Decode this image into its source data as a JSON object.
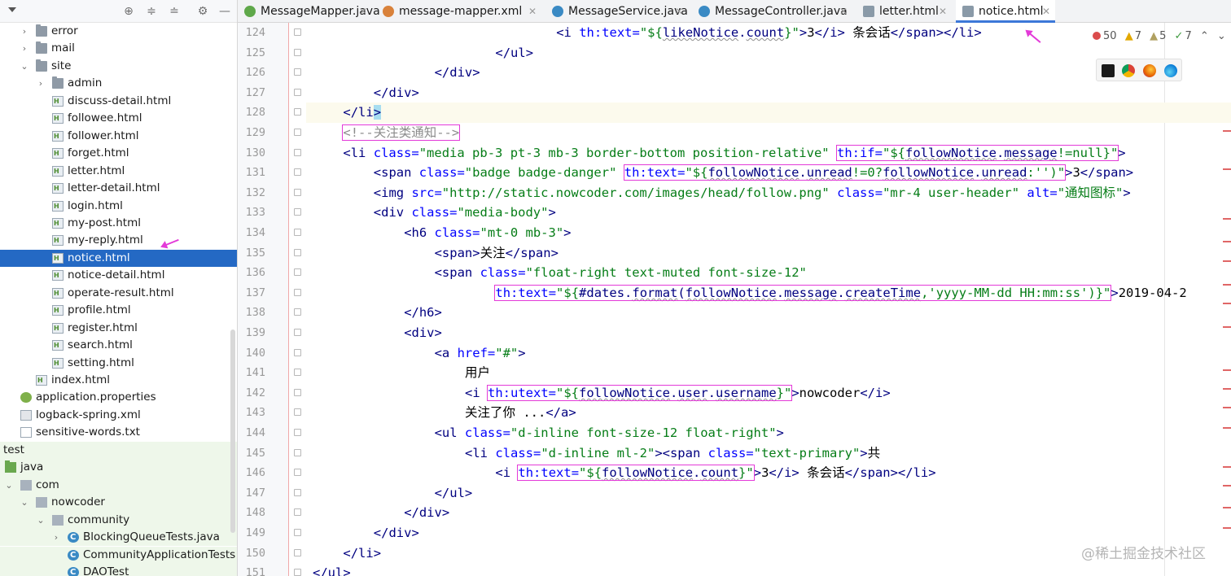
{
  "sidebar": {
    "toolbar_icons": [
      "dropdown-arrow-icon",
      "target-icon",
      "expand-all-icon",
      "collapse-all-icon",
      "gear-icon",
      "hide-icon"
    ],
    "items": [
      {
        "label": "error",
        "type": "folder",
        "expanded": false
      },
      {
        "label": "mail",
        "type": "folder",
        "expanded": false
      },
      {
        "label": "site",
        "type": "folder",
        "expanded": true
      },
      {
        "label": "admin",
        "type": "folder",
        "expanded": false
      },
      {
        "label": "discuss-detail.html",
        "type": "html"
      },
      {
        "label": "followee.html",
        "type": "html"
      },
      {
        "label": "follower.html",
        "type": "html"
      },
      {
        "label": "forget.html",
        "type": "html"
      },
      {
        "label": "letter.html",
        "type": "html"
      },
      {
        "label": "letter-detail.html",
        "type": "html"
      },
      {
        "label": "login.html",
        "type": "html"
      },
      {
        "label": "my-post.html",
        "type": "html"
      },
      {
        "label": "my-reply.html",
        "type": "html"
      },
      {
        "label": "notice.html",
        "type": "html",
        "selected": true
      },
      {
        "label": "notice-detail.html",
        "type": "html"
      },
      {
        "label": "operate-result.html",
        "type": "html"
      },
      {
        "label": "profile.html",
        "type": "html"
      },
      {
        "label": "register.html",
        "type": "html"
      },
      {
        "label": "search.html",
        "type": "html"
      },
      {
        "label": "setting.html",
        "type": "html"
      },
      {
        "label": "index.html",
        "type": "html"
      },
      {
        "label": "application.properties",
        "type": "props"
      },
      {
        "label": "logback-spring.xml",
        "type": "xml"
      },
      {
        "label": "sensitive-words.txt",
        "type": "txt"
      },
      {
        "label": "test",
        "type": "plain"
      },
      {
        "label": "java",
        "type": "folder-green"
      },
      {
        "label": "com",
        "type": "pkg",
        "expanded": true
      },
      {
        "label": "nowcoder",
        "type": "pkg",
        "expanded": true
      },
      {
        "label": "community",
        "type": "pkg",
        "expanded": true
      },
      {
        "label": "BlockingQueueTests.java",
        "type": "javac",
        "expanded": false
      },
      {
        "label": "CommunityApplicationTests",
        "type": "javac"
      },
      {
        "label": "DAOTest",
        "type": "javac"
      }
    ]
  },
  "tabs": [
    {
      "label": "MessageMapper.java",
      "icon": "interface-icon",
      "color": "#5fa84a"
    },
    {
      "label": "message-mapper.xml",
      "icon": "xml-icon",
      "color": "#d9823b"
    },
    {
      "label": "MessageService.java",
      "icon": "class-icon",
      "color": "#3a8ac4"
    },
    {
      "label": "MessageController.java",
      "icon": "class-icon",
      "color": "#3a8ac4"
    },
    {
      "label": "letter.html",
      "icon": "html-icon",
      "color": "#8a9aa8"
    },
    {
      "label": "notice.html",
      "icon": "html-icon",
      "color": "#8a9aa8",
      "active": true
    }
  ],
  "inspections": {
    "errors": "50",
    "warnings": "7",
    "weak_warnings": "5",
    "ok": "7"
  },
  "browsers": [
    "intellij-icon",
    "chrome-icon",
    "firefox-icon",
    "edge-icon"
  ],
  "editor": {
    "lines": [
      {
        "n": "124",
        "indent": 10,
        "tokens": [
          {
            "t": "<i ",
            "c": "tg"
          },
          {
            "t": "th:text=",
            "c": "at"
          },
          {
            "t": "\"${",
            "c": "sv"
          },
          {
            "t": "likeNotice",
            "c": "ex ul"
          },
          {
            "t": ".",
            "c": "ex"
          },
          {
            "t": "count",
            "c": "ex ul"
          },
          {
            "t": "}\"",
            "c": "sv"
          },
          {
            "t": ">",
            "c": "tg"
          },
          {
            "t": "3",
            "c": "tx"
          },
          {
            "t": "</i>",
            "c": "tg"
          },
          {
            "t": " 条会话",
            "c": "tx"
          },
          {
            "t": "</span></li>",
            "c": "tg"
          }
        ]
      },
      {
        "n": "125",
        "indent": 8,
        "tokens": [
          {
            "t": "</ul>",
            "c": "tg"
          }
        ]
      },
      {
        "n": "126",
        "indent": 6,
        "tokens": [
          {
            "t": "</div>",
            "c": "tg"
          }
        ]
      },
      {
        "n": "127",
        "indent": 4,
        "tokens": [
          {
            "t": "</div>",
            "c": "tg"
          }
        ]
      },
      {
        "n": "128",
        "indent": 3,
        "hl": true,
        "tokens": [
          {
            "t": "</li",
            "c": "tg"
          },
          {
            "t": ">",
            "c": "tg brk"
          }
        ]
      },
      {
        "n": "129",
        "indent": 3,
        "tokens": [
          {
            "t": "<!--关注类通知-->",
            "c": "cm box"
          }
        ]
      },
      {
        "n": "130",
        "indent": 3,
        "tokens": [
          {
            "t": "<li ",
            "c": "tg"
          },
          {
            "t": "class=",
            "c": "at"
          },
          {
            "t": "\"media pb-3 pt-3 mb-3 border-bottom position-relative\"",
            "c": "sv"
          },
          {
            "t": " ",
            "c": "tx"
          },
          {
            "t": "th:if=\"${followNotice.message!=null}\"",
            "c": "box",
            "parts": [
              {
                "t": "th:if=",
                "c": "at"
              },
              {
                "t": "\"${",
                "c": "sv"
              },
              {
                "t": "followNotice",
                "c": "ex ul"
              },
              {
                "t": ".",
                "c": "ex"
              },
              {
                "t": "message",
                "c": "ex ul"
              },
              {
                "t": "!=null}\"",
                "c": "sv"
              }
            ]
          },
          {
            "t": ">",
            "c": "tg"
          }
        ]
      },
      {
        "n": "131",
        "indent": 4,
        "tokens": [
          {
            "t": "<span ",
            "c": "tg"
          },
          {
            "t": "class=",
            "c": "at"
          },
          {
            "t": "\"badge badge-danger\"",
            "c": "sv"
          },
          {
            "t": " ",
            "c": "tx"
          },
          {
            "t": "th:text",
            "c": "box",
            "parts": [
              {
                "t": "th:text=",
                "c": "at"
              },
              {
                "t": "\"${",
                "c": "sv"
              },
              {
                "t": "followNotice",
                "c": "ex ul"
              },
              {
                "t": ".",
                "c": "ex"
              },
              {
                "t": "unread",
                "c": "ex ul"
              },
              {
                "t": "!=0?",
                "c": "sv"
              },
              {
                "t": "followNotice",
                "c": "ex ul"
              },
              {
                "t": ".",
                "c": "ex"
              },
              {
                "t": "unread",
                "c": "ex ul"
              },
              {
                "t": ":'')\"",
                "c": "sv"
              }
            ]
          },
          {
            "t": ">",
            "c": "tg"
          },
          {
            "t": "3",
            "c": "tx"
          },
          {
            "t": "</span>",
            "c": "tg"
          }
        ]
      },
      {
        "n": "132",
        "indent": 4,
        "tokens": [
          {
            "t": "<img ",
            "c": "tg"
          },
          {
            "t": "src=",
            "c": "at"
          },
          {
            "t": "\"http://static.nowcoder.com/images/head/follow.png\"",
            "c": "sv"
          },
          {
            "t": " ",
            "c": "tx"
          },
          {
            "t": "class=",
            "c": "at"
          },
          {
            "t": "\"mr-4 user-header\"",
            "c": "sv"
          },
          {
            "t": " ",
            "c": "tx"
          },
          {
            "t": "alt=",
            "c": "at"
          },
          {
            "t": "\"通知图标\"",
            "c": "sv"
          },
          {
            "t": ">",
            "c": "tg"
          }
        ]
      },
      {
        "n": "133",
        "indent": 4,
        "tokens": [
          {
            "t": "<div ",
            "c": "tg"
          },
          {
            "t": "class=",
            "c": "at"
          },
          {
            "t": "\"media-body\"",
            "c": "sv"
          },
          {
            "t": ">",
            "c": "tg"
          }
        ]
      },
      {
        "n": "134",
        "indent": 5,
        "tokens": [
          {
            "t": "<h6 ",
            "c": "tg"
          },
          {
            "t": "class=",
            "c": "at"
          },
          {
            "t": "\"mt-0 mb-3\"",
            "c": "sv"
          },
          {
            "t": ">",
            "c": "tg"
          }
        ]
      },
      {
        "n": "135",
        "indent": 6,
        "tokens": [
          {
            "t": "<span>",
            "c": "tg"
          },
          {
            "t": "关注",
            "c": "tx"
          },
          {
            "t": "</span>",
            "c": "tg"
          }
        ]
      },
      {
        "n": "136",
        "indent": 6,
        "tokens": [
          {
            "t": "<span ",
            "c": "tg"
          },
          {
            "t": "class=",
            "c": "at"
          },
          {
            "t": "\"float-right text-muted font-size-12\"",
            "c": "sv"
          }
        ]
      },
      {
        "n": "137",
        "indent": 8,
        "tokens": [
          {
            "t": "th:text",
            "c": "box",
            "parts": [
              {
                "t": "th:text=",
                "c": "at"
              },
              {
                "t": "\"${",
                "c": "sv"
              },
              {
                "t": "#dates",
                "c": "ex"
              },
              {
                "t": ".",
                "c": "ex"
              },
              {
                "t": "format",
                "c": "ex ul"
              },
              {
                "t": "(",
                "c": "ex"
              },
              {
                "t": "followNotice",
                "c": "ex ul"
              },
              {
                "t": ".",
                "c": "ex"
              },
              {
                "t": "message",
                "c": "ex ul"
              },
              {
                "t": ".",
                "c": "ex"
              },
              {
                "t": "createTime",
                "c": "ex ul"
              },
              {
                "t": ",'yyyy-MM-dd HH:mm:ss')}\"",
                "c": "sv"
              }
            ]
          },
          {
            "t": ">",
            "c": "tg"
          },
          {
            "t": "2019-04-2",
            "c": "tx"
          }
        ]
      },
      {
        "n": "138",
        "indent": 5,
        "tokens": [
          {
            "t": "</h6>",
            "c": "tg"
          }
        ]
      },
      {
        "n": "139",
        "indent": 5,
        "tokens": [
          {
            "t": "<div>",
            "c": "tg"
          }
        ]
      },
      {
        "n": "140",
        "indent": 6,
        "tokens": [
          {
            "t": "<a ",
            "c": "tg"
          },
          {
            "t": "href=",
            "c": "at"
          },
          {
            "t": "\"#\"",
            "c": "sv"
          },
          {
            "t": ">",
            "c": "tg"
          }
        ]
      },
      {
        "n": "141",
        "indent": 7,
        "tokens": [
          {
            "t": "用户",
            "c": "tx"
          }
        ]
      },
      {
        "n": "142",
        "indent": 7,
        "tokens": [
          {
            "t": "<i ",
            "c": "tg"
          },
          {
            "t": "th:utext",
            "c": "box",
            "parts": [
              {
                "t": "th:utext=",
                "c": "at"
              },
              {
                "t": "\"${",
                "c": "sv"
              },
              {
                "t": "followNotice",
                "c": "ex ul"
              },
              {
                "t": ".",
                "c": "ex"
              },
              {
                "t": "user",
                "c": "ex ul"
              },
              {
                "t": ".",
                "c": "ex"
              },
              {
                "t": "username",
                "c": "ex ul"
              },
              {
                "t": "}\"",
                "c": "sv"
              }
            ]
          },
          {
            "t": ">",
            "c": "tg"
          },
          {
            "t": "nowcoder",
            "c": "tx"
          },
          {
            "t": "</i>",
            "c": "tg"
          }
        ]
      },
      {
        "n": "143",
        "indent": 7,
        "tokens": [
          {
            "t": "关注了你 ...",
            "c": "tx"
          },
          {
            "t": "</a>",
            "c": "tg"
          }
        ]
      },
      {
        "n": "144",
        "indent": 6,
        "tokens": [
          {
            "t": "<ul ",
            "c": "tg"
          },
          {
            "t": "class=",
            "c": "at"
          },
          {
            "t": "\"d-inline font-size-12 float-right\"",
            "c": "sv"
          },
          {
            "t": ">",
            "c": "tg"
          }
        ]
      },
      {
        "n": "145",
        "indent": 7,
        "tokens": [
          {
            "t": "<li ",
            "c": "tg"
          },
          {
            "t": "class=",
            "c": "at"
          },
          {
            "t": "\"d-inline ml-2\"",
            "c": "sv"
          },
          {
            "t": "><span ",
            "c": "tg"
          },
          {
            "t": "class=",
            "c": "at"
          },
          {
            "t": "\"text-primary\"",
            "c": "sv"
          },
          {
            "t": ">",
            "c": "tg"
          },
          {
            "t": "共",
            "c": "tx"
          }
        ]
      },
      {
        "n": "146",
        "indent": 8,
        "tokens": [
          {
            "t": "<i ",
            "c": "tg"
          },
          {
            "t": "th:text",
            "c": "box",
            "parts": [
              {
                "t": "th:text=",
                "c": "at"
              },
              {
                "t": "\"${",
                "c": "sv"
              },
              {
                "t": "followNotice",
                "c": "ex ul"
              },
              {
                "t": ".",
                "c": "ex"
              },
              {
                "t": "count",
                "c": "ex ul"
              },
              {
                "t": "}\"",
                "c": "sv"
              }
            ]
          },
          {
            "t": ">",
            "c": "tg"
          },
          {
            "t": "3",
            "c": "tx"
          },
          {
            "t": "</i>",
            "c": "tg"
          },
          {
            "t": " 条会话",
            "c": "tx"
          },
          {
            "t": "</span></li>",
            "c": "tg"
          }
        ]
      },
      {
        "n": "147",
        "indent": 6,
        "tokens": [
          {
            "t": "</ul>",
            "c": "tg"
          }
        ]
      },
      {
        "n": "148",
        "indent": 5,
        "tokens": [
          {
            "t": "</div>",
            "c": "tg"
          }
        ]
      },
      {
        "n": "149",
        "indent": 4,
        "tokens": [
          {
            "t": "</div>",
            "c": "tg"
          }
        ]
      },
      {
        "n": "150",
        "indent": 3,
        "tokens": [
          {
            "t": "</li>",
            "c": "tg"
          }
        ]
      },
      {
        "n": "151",
        "indent": 2,
        "tokens": [
          {
            "t": "</ul>",
            "c": "tg"
          }
        ]
      }
    ]
  },
  "watermark": "@稀土掘金技术社区"
}
